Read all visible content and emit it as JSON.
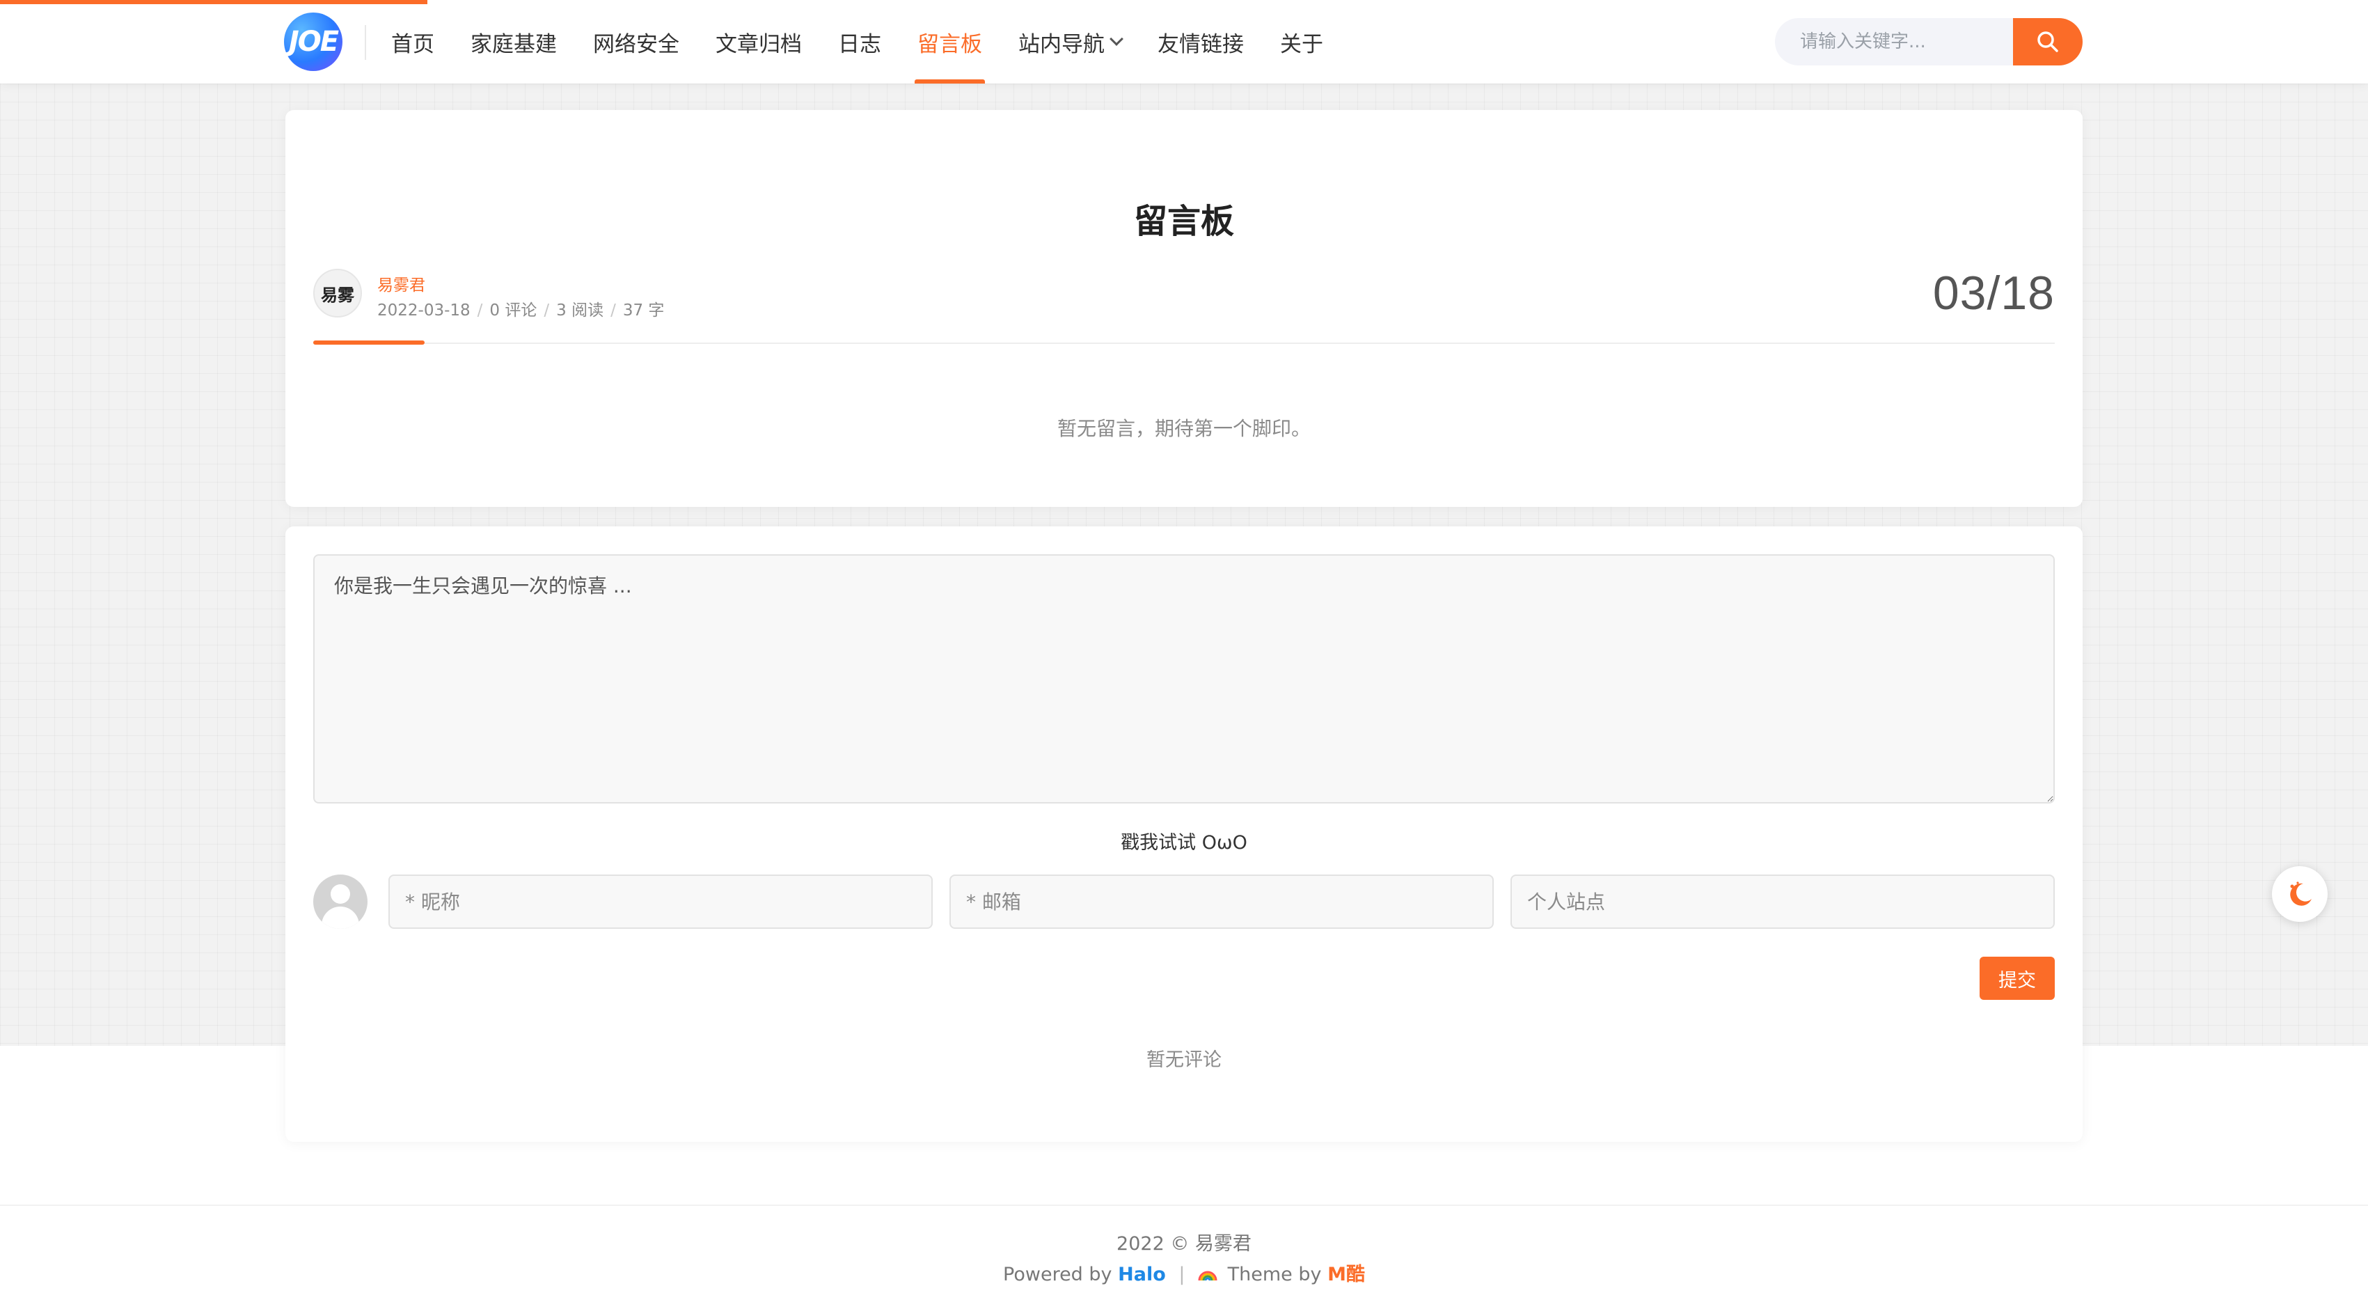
{
  "header": {
    "logo_text": "JOE",
    "nav": [
      {
        "label": "首页"
      },
      {
        "label": "家庭基建"
      },
      {
        "label": "网络安全"
      },
      {
        "label": "文章归档"
      },
      {
        "label": "日志"
      },
      {
        "label": "留言板",
        "active": true
      },
      {
        "label": "站内导航",
        "has_dropdown": true
      },
      {
        "label": "友情链接"
      },
      {
        "label": "关于"
      }
    ],
    "search": {
      "placeholder": "请输入关键字..."
    },
    "accent_color": "#fb6c28"
  },
  "post": {
    "title": "留言板",
    "author": {
      "name": "易雾君",
      "avatar_text": "易雾"
    },
    "date": "2022-03-18",
    "comments": "0 评论",
    "reads": "3 阅读",
    "words": "37 字",
    "date_big": "03/18",
    "empty_message": "暂无留言，期待第一个脚印。"
  },
  "comment_form": {
    "textarea_placeholder": "你是我一生只会遇见一次的惊喜 ...",
    "owo_label": "戳我试试 OωO",
    "nickname_placeholder": "* 昵称",
    "email_placeholder": "* 邮箱",
    "site_placeholder": "个人站点",
    "submit_label": "提交",
    "no_comments": "暂无评论"
  },
  "footer": {
    "copyright": "2022 © 易雾君",
    "powered_by": "Powered by",
    "halo": "Halo",
    "theme_by": "Theme by",
    "mku": "M酷"
  }
}
